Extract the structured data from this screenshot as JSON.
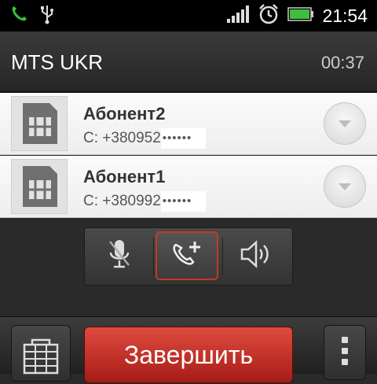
{
  "status_bar": {
    "time": "21:54",
    "icons": [
      "phone-call-icon",
      "usb-icon",
      "signal-icon",
      "alarm-clock-icon",
      "battery-icon"
    ],
    "colors": {
      "phone": "#3cbf3c",
      "battery": "#3cbf3c"
    }
  },
  "header": {
    "title": "MTS UKR",
    "call_duration": "00:37"
  },
  "calls": [
    {
      "name": "Абонент2",
      "number_prefix": "С: +380952",
      "number_masked": "••••••",
      "icon": "sim-card-icon"
    },
    {
      "name": "Абонент1",
      "number_prefix": "С: +380992",
      "number_masked": "••••••",
      "icon": "sim-card-icon"
    }
  ],
  "controls": {
    "mute_icon": "microphone-mute-icon",
    "add_call_icon": "add-call-icon",
    "speaker_icon": "speaker-icon",
    "highlight_color": "#c0392b"
  },
  "bottom_bar": {
    "end_call_label": "Завершить",
    "end_call_color": "#c72f24"
  }
}
